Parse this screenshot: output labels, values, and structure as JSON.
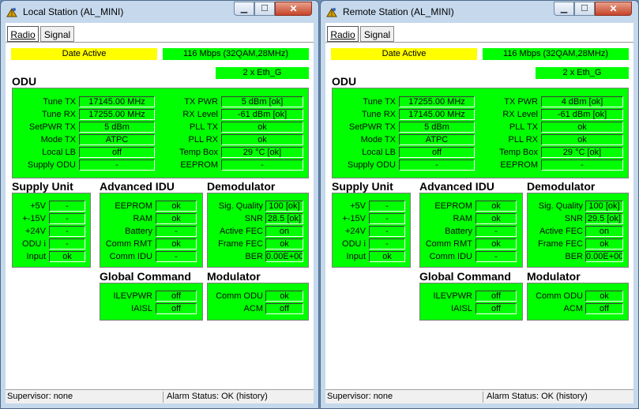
{
  "windows": [
    {
      "id": "left",
      "title": "Local Station (AL_MINI)",
      "tabs": [
        "Radio",
        "Signal"
      ],
      "top_bars": {
        "status": "Date Active",
        "capacity": "116 Mbps (32QAM,28MHz)",
        "interface": "2 x Eth_G"
      },
      "odu": {
        "label": "ODU",
        "left": [
          {
            "label": "Tune TX",
            "value": "17145.00 MHz"
          },
          {
            "label": "Tune RX",
            "value": "17255.00 MHz"
          },
          {
            "label": "SetPWR TX",
            "value": "5 dBm"
          },
          {
            "label": "Mode TX",
            "value": "ATPC"
          },
          {
            "label": "Local LB",
            "value": "off"
          },
          {
            "label": "Supply ODU",
            "value": "-"
          }
        ],
        "right": [
          {
            "label": "TX PWR",
            "value": "5 dBm [ok]"
          },
          {
            "label": "RX Level",
            "value": "-61 dBm [ok]"
          },
          {
            "label": "PLL TX",
            "value": "ok"
          },
          {
            "label": "PLL RX",
            "value": "ok"
          },
          {
            "label": "Temp Box",
            "value": "29 °C [ok]"
          },
          {
            "label": "EEPROM",
            "value": "-"
          }
        ]
      },
      "supply_unit": {
        "label": "Supply Unit",
        "rows": [
          {
            "label": "+5V",
            "value": "-"
          },
          {
            "label": "+-15V",
            "value": "-"
          },
          {
            "label": "+24V",
            "value": "-"
          },
          {
            "label": "ODU  i",
            "value": "-"
          },
          {
            "label": "Input",
            "value": "ok"
          }
        ]
      },
      "advanced_idu": {
        "label": "Advanced IDU",
        "rows": [
          {
            "label": "EEPROM",
            "value": "ok"
          },
          {
            "label": "RAM",
            "value": "ok"
          },
          {
            "label": "Battery",
            "value": "-"
          },
          {
            "label": "Comm RMT",
            "value": "ok"
          },
          {
            "label": "Comm IDU",
            "value": "-"
          }
        ]
      },
      "demodulator": {
        "label": "Demodulator",
        "rows": [
          {
            "label": "Sig. Quality",
            "value": "100 [ok]"
          },
          {
            "label": "SNR",
            "value": "28.5 [ok]"
          },
          {
            "label": "Active FEC",
            "value": "on"
          },
          {
            "label": "Frame FEC",
            "value": "ok"
          },
          {
            "label": "BER",
            "value": "0.00E+00"
          }
        ]
      },
      "global_command": {
        "label": "Global Command",
        "rows": [
          {
            "label": "ILEVPWR",
            "value": "off"
          },
          {
            "label": "IAISL",
            "value": "off"
          }
        ]
      },
      "modulator": {
        "label": "Modulator",
        "rows": [
          {
            "label": "Comm ODU",
            "value": "ok"
          },
          {
            "label": "ACM",
            "value": "off"
          }
        ]
      },
      "status": {
        "supervisor": "Supervisor: none",
        "alarm": "Alarm Status: OK (history)"
      }
    },
    {
      "id": "right",
      "title": "Remote Station (AL_MINI)",
      "tabs": [
        "Radio",
        "Signal"
      ],
      "top_bars": {
        "status": "Date Active",
        "capacity": "116 Mbps (32QAM,28MHz)",
        "interface": "2 x Eth_G"
      },
      "odu": {
        "label": "ODU",
        "left": [
          {
            "label": "Tune TX",
            "value": "17255.00 MHz"
          },
          {
            "label": "Tune RX",
            "value": "17145.00 MHz"
          },
          {
            "label": "SetPWR TX",
            "value": "5 dBm"
          },
          {
            "label": "Mode TX",
            "value": "ATPC"
          },
          {
            "label": "Local LB",
            "value": "off"
          },
          {
            "label": "Supply ODU",
            "value": "-"
          }
        ],
        "right": [
          {
            "label": "TX PWR",
            "value": "4 dBm [ok]"
          },
          {
            "label": "RX Level",
            "value": "-61 dBm [ok]"
          },
          {
            "label": "PLL TX",
            "value": "ok"
          },
          {
            "label": "PLL RX",
            "value": "ok"
          },
          {
            "label": "Temp Box",
            "value": "29 °C [ok]"
          },
          {
            "label": "EEPROM",
            "value": "-"
          }
        ]
      },
      "supply_unit": {
        "label": "Supply Unit",
        "rows": [
          {
            "label": "+5V",
            "value": "-"
          },
          {
            "label": "+-15V",
            "value": "-"
          },
          {
            "label": "+24V",
            "value": "-"
          },
          {
            "label": "ODU  i",
            "value": "-"
          },
          {
            "label": "Input",
            "value": "ok"
          }
        ]
      },
      "advanced_idu": {
        "label": "Advanced IDU",
        "rows": [
          {
            "label": "EEPROM",
            "value": "ok"
          },
          {
            "label": "RAM",
            "value": "ok"
          },
          {
            "label": "Battery",
            "value": "-"
          },
          {
            "label": "Comm RMT",
            "value": "ok"
          },
          {
            "label": "Comm IDU",
            "value": "-"
          }
        ]
      },
      "demodulator": {
        "label": "Demodulator",
        "rows": [
          {
            "label": "Sig. Quality",
            "value": "100 [ok]"
          },
          {
            "label": "SNR",
            "value": "29.5 [ok]"
          },
          {
            "label": "Active FEC",
            "value": "on"
          },
          {
            "label": "Frame FEC",
            "value": "ok"
          },
          {
            "label": "BER",
            "value": "0.00E+00"
          }
        ]
      },
      "global_command": {
        "label": "Global Command",
        "rows": [
          {
            "label": "ILEVPWR",
            "value": "off"
          },
          {
            "label": "IAISL",
            "value": "off"
          }
        ]
      },
      "modulator": {
        "label": "Modulator",
        "rows": [
          {
            "label": "Comm ODU",
            "value": "ok"
          },
          {
            "label": "ACM",
            "value": "off"
          }
        ]
      },
      "status": {
        "supervisor": "Supervisor: none",
        "alarm": "Alarm Status: OK (history)"
      }
    }
  ],
  "icons": {
    "app": "station-icon",
    "minimize": "minimize-icon",
    "maximize": "maximize-icon",
    "close": "close-icon"
  },
  "colors": {
    "green": "#00ff00",
    "yellow": "#ffff00",
    "titlebar": "#c5d8ec"
  }
}
